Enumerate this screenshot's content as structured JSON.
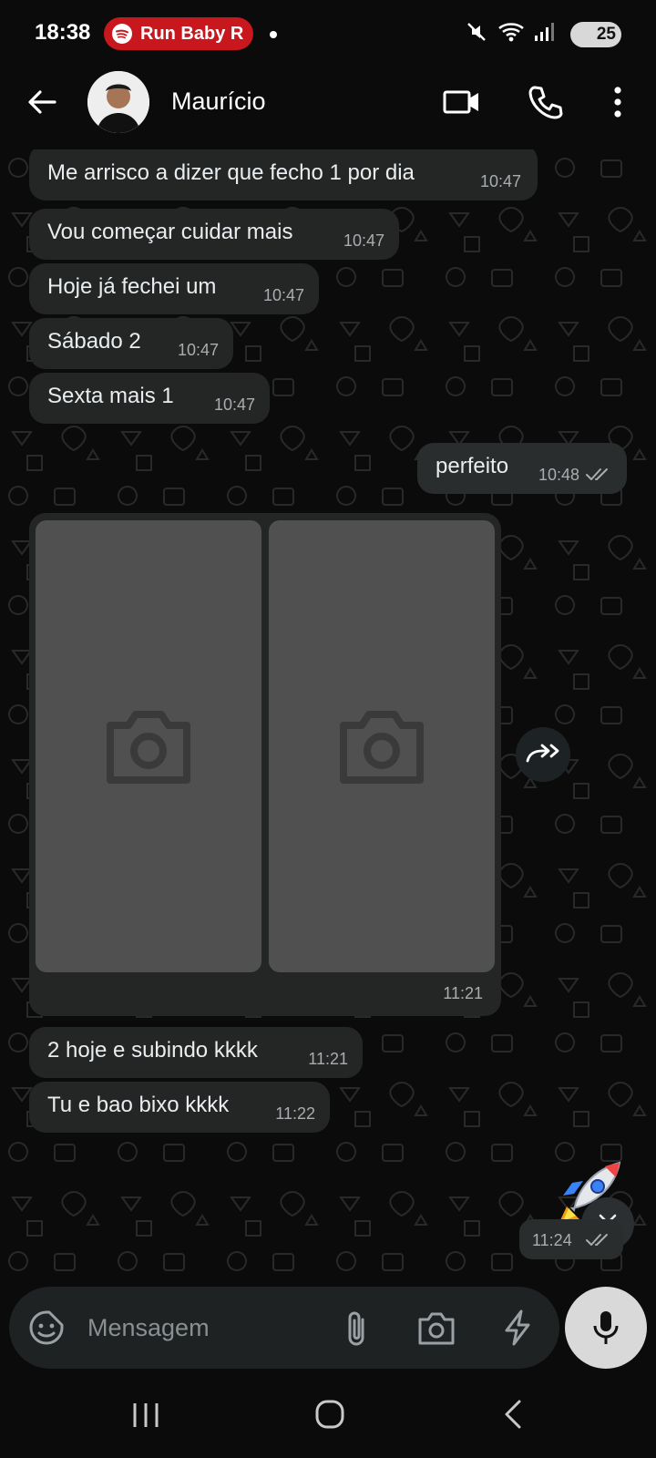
{
  "status_bar": {
    "time": "18:38",
    "media_label": "Run Baby R",
    "battery": "25",
    "icons": [
      "spotify-icon",
      "mute-icon",
      "wifi-icon",
      "signal-icon",
      "battery-icon"
    ]
  },
  "header": {
    "contact_name": "Maurício",
    "icons": [
      "back-arrow-icon",
      "video-call-icon",
      "phone-icon",
      "more-vert-icon"
    ]
  },
  "messages": [
    {
      "dir": "in",
      "text": "Me arrisco a dizer que fecho 1 por dia",
      "time": "10:47"
    },
    {
      "dir": "in",
      "text": "Vou começar cuidar mais",
      "time": "10:47"
    },
    {
      "dir": "in",
      "text": "Hoje já fechei um",
      "time": "10:47"
    },
    {
      "dir": "in",
      "text": "Sábado 2",
      "time": "10:47"
    },
    {
      "dir": "in",
      "text": "Sexta mais 1",
      "time": "10:47"
    },
    {
      "dir": "out",
      "text": "perfeito",
      "time": "10:48",
      "status": "read-double-check"
    },
    {
      "dir": "in",
      "type": "photo-album",
      "count": 2,
      "time": "11:21"
    },
    {
      "dir": "in",
      "text": "2 hoje e subindo kkkk",
      "time": "11:21"
    },
    {
      "dir": "in",
      "text": "Tu e bao bixo kkkk",
      "time": "11:22"
    },
    {
      "dir": "out",
      "type": "sticker",
      "emoji": "🚀",
      "time": "11:24",
      "status": "read-double-check"
    }
  ],
  "input": {
    "placeholder": "Mensagem",
    "value": ""
  },
  "colors": {
    "background": "#0b0b0b",
    "incoming_bubble": "#242626",
    "outgoing_bubble": "#2a2d2e",
    "spotify_pill": "#c8181e",
    "text": "#e9edef",
    "timestamp": "#a9adb0",
    "mic_button": "#d9d9d9"
  }
}
